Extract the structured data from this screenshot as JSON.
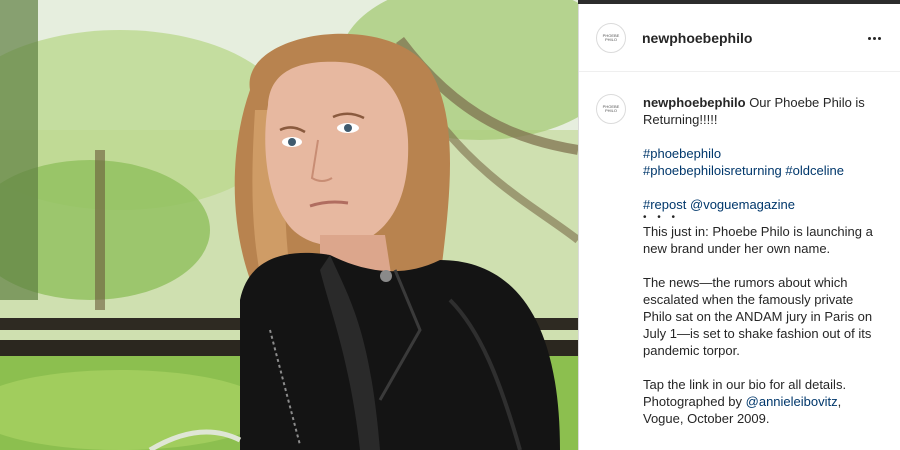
{
  "post": {
    "image": {
      "alt_subject": "portrait"
    },
    "author": {
      "username": "newphoebephilo",
      "avatar_text": "PHOEBE PHILO"
    },
    "menu_icon": "more-horizontal-icon",
    "caption": {
      "intro": "Our Phoebe Philo is Returning!!!!!",
      "hashtags_line1": "#phoebephilo",
      "hashtags_line2a": "#phoebephiloisreturning",
      "hashtags_line2b": "#oldceline",
      "repost": "#repost",
      "mention": "@voguemagazine",
      "dots": "• • •",
      "para1": "This just in: Phoebe Philo is launching a new brand under her own name.",
      "para2": "The news—the rumors about which escalated when the famously private Philo sat on the ANDAM jury in Paris on July 1—is set to shake fashion out of its pandemic torpor.",
      "para3a": "Tap the link in our bio for all details. Photographed by ",
      "para3_mention": "@annieleibovitz",
      "para3b": ", Vogue, October 2009."
    }
  },
  "colors": {
    "link": "#00376b",
    "text": "#262626",
    "border": "#dbdbdb"
  }
}
